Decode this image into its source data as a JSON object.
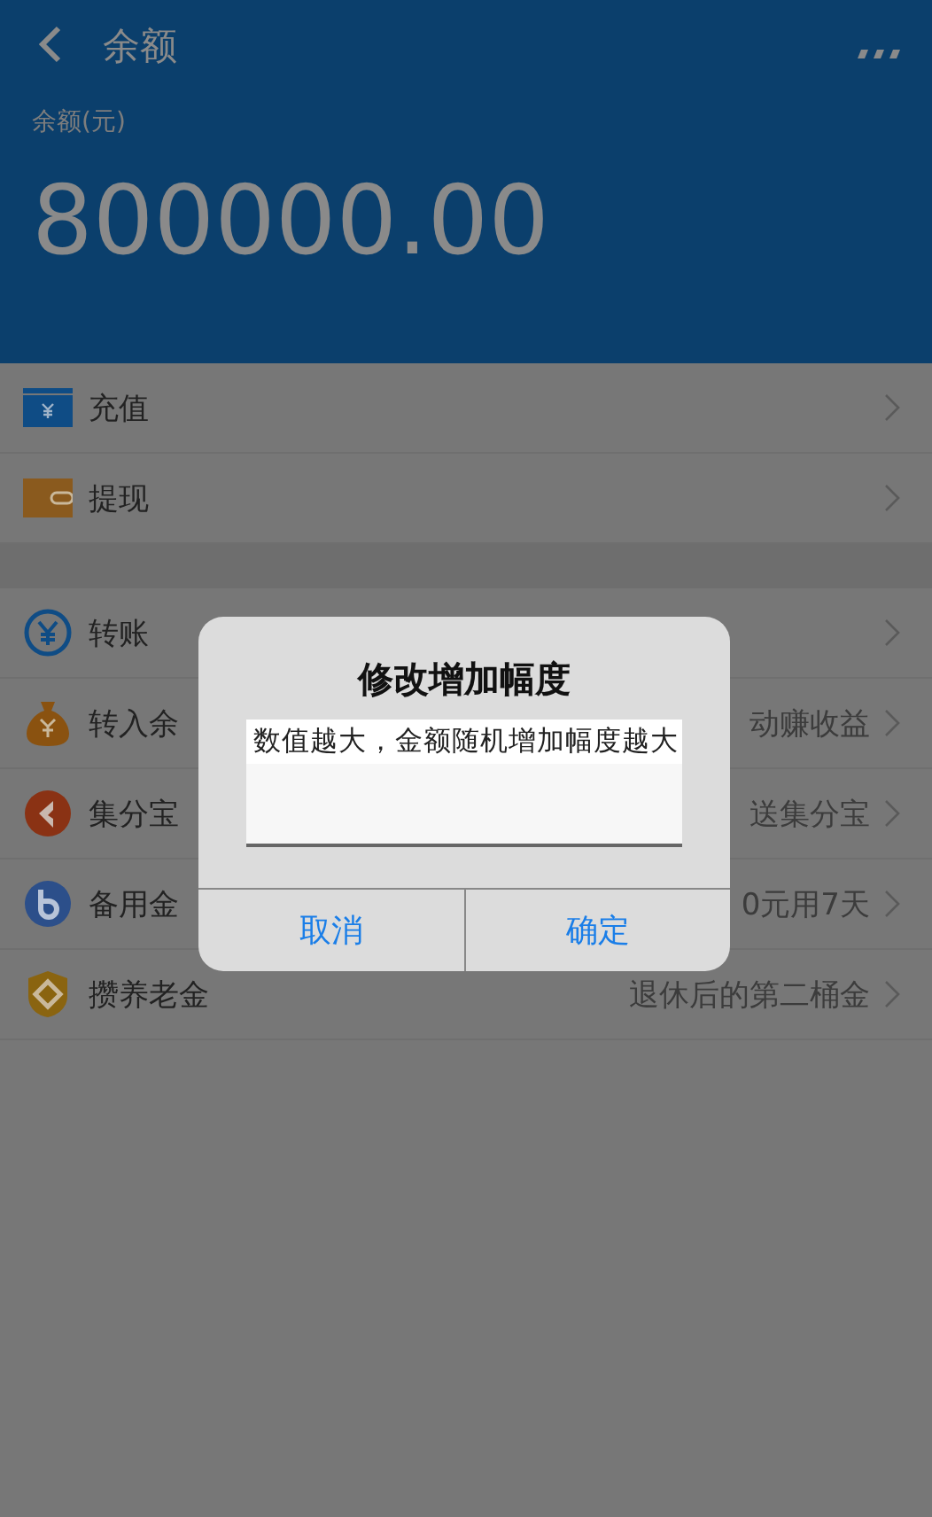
{
  "header": {
    "title": "余额",
    "balance_label": "余额(元)",
    "balance": "800000.00"
  },
  "groups": [
    [
      {
        "label": "充值"
      },
      {
        "label": "提现"
      }
    ],
    [
      {
        "label": "转账"
      },
      {
        "label": "转入余",
        "detail": "动赚收益"
      },
      {
        "label": "集分宝",
        "detail": "送集分宝"
      },
      {
        "label": "备用金",
        "detail": "0元用7天"
      },
      {
        "label": "攒养老金",
        "detail": "退休后的第二桶金"
      }
    ]
  ],
  "dialog": {
    "title": "修改增加幅度",
    "message": "数值越大，金额随机增加幅度越大",
    "buttons": [
      "取消",
      "确定"
    ]
  }
}
